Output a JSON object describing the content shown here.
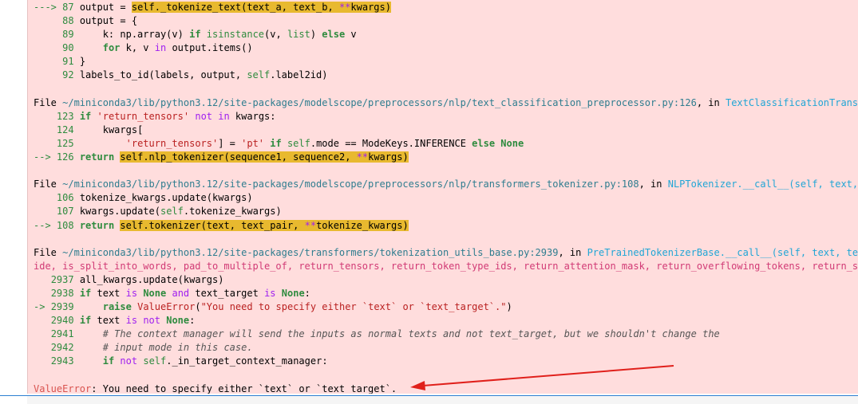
{
  "lines": [
    {
      "arrow": "---> ",
      "num": "87",
      "segs": [
        {
          "t": "output = ",
          "c": ""
        },
        {
          "t": "self",
          "c": "hl"
        },
        {
          "t": "._tokenize_text(text_a, text_b, ",
          "c": "hl"
        },
        {
          "t": "**",
          "c": "hl op"
        },
        {
          "t": "kwargs)",
          "c": "hl"
        }
      ]
    },
    {
      "arrow": "     ",
      "num": "88",
      "segs": [
        {
          "t": "output = {",
          "c": ""
        }
      ]
    },
    {
      "arrow": "     ",
      "num": "89",
      "segs": [
        {
          "t": "    k: np.array(v) ",
          "c": ""
        },
        {
          "t": "if",
          "c": "kw"
        },
        {
          "t": " ",
          "c": ""
        },
        {
          "t": "isinstance",
          "c": "nb"
        },
        {
          "t": "(v, ",
          "c": ""
        },
        {
          "t": "list",
          "c": "nb"
        },
        {
          "t": ") ",
          "c": ""
        },
        {
          "t": "else",
          "c": "kw"
        },
        {
          "t": " v",
          "c": ""
        }
      ]
    },
    {
      "arrow": "     ",
      "num": "90",
      "segs": [
        {
          "t": "    ",
          "c": ""
        },
        {
          "t": "for",
          "c": "kw"
        },
        {
          "t": " k, v ",
          "c": ""
        },
        {
          "t": "in",
          "c": "op"
        },
        {
          "t": " output.items()",
          "c": ""
        }
      ]
    },
    {
      "arrow": "     ",
      "num": "91",
      "segs": [
        {
          "t": "}",
          "c": ""
        }
      ]
    },
    {
      "arrow": "     ",
      "num": "92",
      "segs": [
        {
          "t": "labels_to_id(labels, output, ",
          "c": ""
        },
        {
          "t": "self",
          "c": "nb"
        },
        {
          "t": ".label2id)",
          "c": ""
        }
      ]
    },
    {
      "blank": true
    },
    {
      "file": true,
      "segs": [
        {
          "t": "File ",
          "c": ""
        },
        {
          "t": "~/miniconda3/lib/python3.12/site-packages/modelscope/preprocessors/nlp/text_classification_preprocessor.py:126",
          "c": "pth"
        },
        {
          "t": ", in ",
          "c": ""
        },
        {
          "t": "TextClassificationTransformersPreprocessor.__call__(self, data, **kwargs)",
          "c": "fn"
        }
      ]
    },
    {
      "arrow": "    ",
      "num": "123",
      "segs": [
        {
          "t": "if",
          "c": "kw"
        },
        {
          "t": " ",
          "c": ""
        },
        {
          "t": "'return_tensors'",
          "c": "str"
        },
        {
          "t": " ",
          "c": ""
        },
        {
          "t": "not in",
          "c": "op"
        },
        {
          "t": " kwargs:",
          "c": ""
        }
      ]
    },
    {
      "arrow": "    ",
      "num": "124",
      "segs": [
        {
          "t": "    kwargs[",
          "c": ""
        }
      ]
    },
    {
      "arrow": "    ",
      "num": "125",
      "segs": [
        {
          "t": "        ",
          "c": ""
        },
        {
          "t": "'return_tensors'",
          "c": "str"
        },
        {
          "t": "] = ",
          "c": ""
        },
        {
          "t": "'pt'",
          "c": "str"
        },
        {
          "t": " ",
          "c": ""
        },
        {
          "t": "if",
          "c": "kw"
        },
        {
          "t": " ",
          "c": ""
        },
        {
          "t": "self",
          "c": "nb"
        },
        {
          "t": ".mode == ModeKeys.INFERENCE ",
          "c": ""
        },
        {
          "t": "else",
          "c": "kw"
        },
        {
          "t": " ",
          "c": ""
        },
        {
          "t": "None",
          "c": "kw"
        }
      ]
    },
    {
      "arrow": "--> ",
      "num": "126",
      "segs": [
        {
          "t": "return",
          "c": "kw"
        },
        {
          "t": " ",
          "c": ""
        },
        {
          "t": "self",
          "c": "hl"
        },
        {
          "t": ".nlp_tokenizer(sequence1, sequence2, ",
          "c": "hl"
        },
        {
          "t": "**",
          "c": "hl op"
        },
        {
          "t": "kwargs)",
          "c": "hl"
        }
      ]
    },
    {
      "blank": true
    },
    {
      "file": true,
      "segs": [
        {
          "t": "File ",
          "c": ""
        },
        {
          "t": "~/miniconda3/lib/python3.12/site-packages/modelscope/preprocessors/nlp/transformers_tokenizer.py:108",
          "c": "pth"
        },
        {
          "t": ", in ",
          "c": ""
        },
        {
          "t": "NLPTokenizer.__call__(self, text, text_pair, **kwargs)",
          "c": "fn"
        }
      ]
    },
    {
      "arrow": "    ",
      "num": "106",
      "segs": [
        {
          "t": "tokenize_kwargs.update(kwargs)",
          "c": ""
        }
      ]
    },
    {
      "arrow": "    ",
      "num": "107",
      "segs": [
        {
          "t": "kwargs.update(",
          "c": ""
        },
        {
          "t": "self",
          "c": "nb"
        },
        {
          "t": ".tokenize_kwargs)",
          "c": ""
        }
      ]
    },
    {
      "arrow": "--> ",
      "num": "108",
      "segs": [
        {
          "t": "return",
          "c": "kw"
        },
        {
          "t": " ",
          "c": ""
        },
        {
          "t": "self",
          "c": "hl"
        },
        {
          "t": ".tokenizer(text, text_pair, ",
          "c": "hl"
        },
        {
          "t": "**",
          "c": "hl op"
        },
        {
          "t": "tokenize_kwargs)",
          "c": "hl"
        }
      ]
    },
    {
      "blank": true
    },
    {
      "file": true,
      "segs": [
        {
          "t": "File ",
          "c": ""
        },
        {
          "t": "~/miniconda3/lib/python3.12/site-packages/transformers/tokenization_utils_base.py:2939",
          "c": "pth"
        },
        {
          "t": ", in ",
          "c": ""
        },
        {
          "t": "PreTrainedTokenizerBase.__call__(self, text, text_pair, text_target, text_pair_target, add_special_tokens, padding, truncation, max_length, str",
          "c": "fn"
        }
      ]
    },
    {
      "overflow": true,
      "segs": [
        {
          "t": "ide, is_split_into_words, pad_to_multiple_of, return_tensors, return_token_type_ids, return_attention_mask, return_overflowing_tokens, return_special_tokens_mask, return_offsets_mapping, return_length, verbose, **kwargs)",
          "c": "ovf"
        }
      ]
    },
    {
      "arrow": "   ",
      "num": "2937",
      "segs": [
        {
          "t": "all_kwargs.update(kwargs)",
          "c": ""
        }
      ]
    },
    {
      "arrow": "   ",
      "num": "2938",
      "segs": [
        {
          "t": "if",
          "c": "kw"
        },
        {
          "t": " text ",
          "c": ""
        },
        {
          "t": "is",
          "c": "op"
        },
        {
          "t": " ",
          "c": ""
        },
        {
          "t": "None",
          "c": "kw"
        },
        {
          "t": " ",
          "c": ""
        },
        {
          "t": "and",
          "c": "op"
        },
        {
          "t": " text_target ",
          "c": ""
        },
        {
          "t": "is",
          "c": "op"
        },
        {
          "t": " ",
          "c": ""
        },
        {
          "t": "None",
          "c": "kw"
        },
        {
          "t": ":",
          "c": ""
        }
      ]
    },
    {
      "arrow": "-> ",
      "num": "2939",
      "segs": [
        {
          "t": "    ",
          "c": ""
        },
        {
          "t": "raise",
          "c": "kw"
        },
        {
          "t": " ",
          "c": ""
        },
        {
          "t": "ValueError",
          "c": "str"
        },
        {
          "t": "(",
          "c": ""
        },
        {
          "t": "\"You need to specify either `text` or `text_target`.\"",
          "c": "str"
        },
        {
          "t": ")",
          "c": ""
        }
      ]
    },
    {
      "arrow": "   ",
      "num": "2940",
      "segs": [
        {
          "t": "if",
          "c": "kw"
        },
        {
          "t": " text ",
          "c": ""
        },
        {
          "t": "is not",
          "c": "op"
        },
        {
          "t": " ",
          "c": ""
        },
        {
          "t": "None",
          "c": "kw"
        },
        {
          "t": ":",
          "c": ""
        }
      ]
    },
    {
      "arrow": "   ",
      "num": "2941",
      "segs": [
        {
          "t": "    ",
          "c": ""
        },
        {
          "t": "# The context manager will send the inputs as normal texts and not text_target, but we shouldn't change the",
          "c": "cmt"
        }
      ]
    },
    {
      "arrow": "   ",
      "num": "2942",
      "segs": [
        {
          "t": "    ",
          "c": ""
        },
        {
          "t": "# input mode in this case.",
          "c": "cmt"
        }
      ]
    },
    {
      "arrow": "   ",
      "num": "2943",
      "segs": [
        {
          "t": "    ",
          "c": ""
        },
        {
          "t": "if",
          "c": "kw"
        },
        {
          "t": " ",
          "c": ""
        },
        {
          "t": "not",
          "c": "op"
        },
        {
          "t": " ",
          "c": ""
        },
        {
          "t": "self",
          "c": "nb"
        },
        {
          "t": "._in_target_context_manager:",
          "c": ""
        }
      ]
    },
    {
      "blank": true
    },
    {
      "error": true,
      "segs": [
        {
          "t": "ValueError",
          "c": "err"
        },
        {
          "t": ": You need to specify either `text` or `text_target`.",
          "c": ""
        }
      ]
    }
  ],
  "colors": {
    "output_bg": "#ffdddd",
    "highlight": "#e8b92f",
    "arrow_annotation": "#e0201b"
  }
}
